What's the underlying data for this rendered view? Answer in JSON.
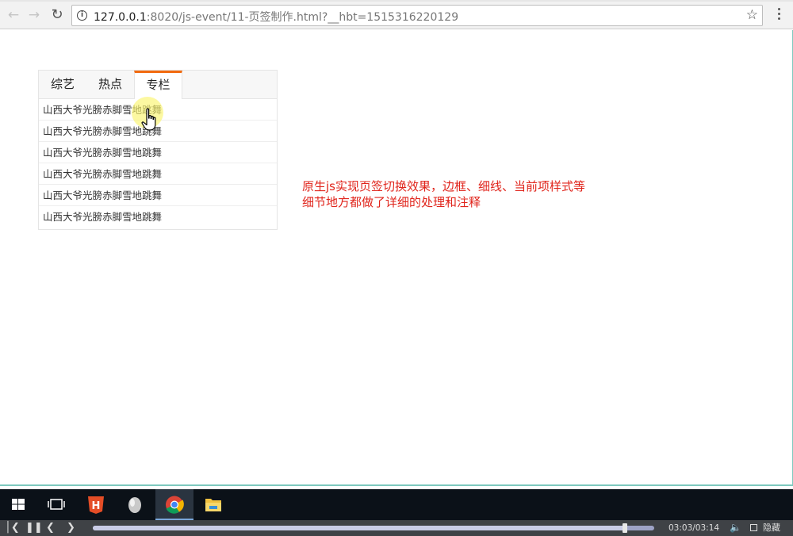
{
  "browser": {
    "url_host": "127.0.0.1",
    "url_rest": ":8020/js-event/11-页签制作.html?__hbt=1515316220129"
  },
  "tabs": [
    {
      "label": "综艺",
      "active": false
    },
    {
      "label": "热点",
      "active": false
    },
    {
      "label": "专栏",
      "active": true
    }
  ],
  "list_items": [
    "山西大爷光膀赤脚雪地跳舞",
    "山西大爷光膀赤脚雪地跳舞",
    "山西大爷光膀赤脚雪地跳舞",
    "山西大爷光膀赤脚雪地跳舞",
    "山西大爷光膀赤脚雪地跳舞",
    "山西大爷光膀赤脚雪地跳舞"
  ],
  "note": {
    "line1": "原生js实现页签切换效果，边框、细线、当前项样式等",
    "line2": "细节地方都做了详细的处理和注释"
  },
  "colors": {
    "active_tab_border": "#f26a0f",
    "note_text": "#e0241b"
  },
  "taskbar": {
    "items": [
      "windows-start",
      "task-view",
      "hbuilder",
      "app-egg",
      "chrome",
      "file-explorer"
    ],
    "active": "chrome"
  },
  "player": {
    "time": "03:03/03:14",
    "progress": 0.948,
    "hide_label": "隐藏"
  }
}
